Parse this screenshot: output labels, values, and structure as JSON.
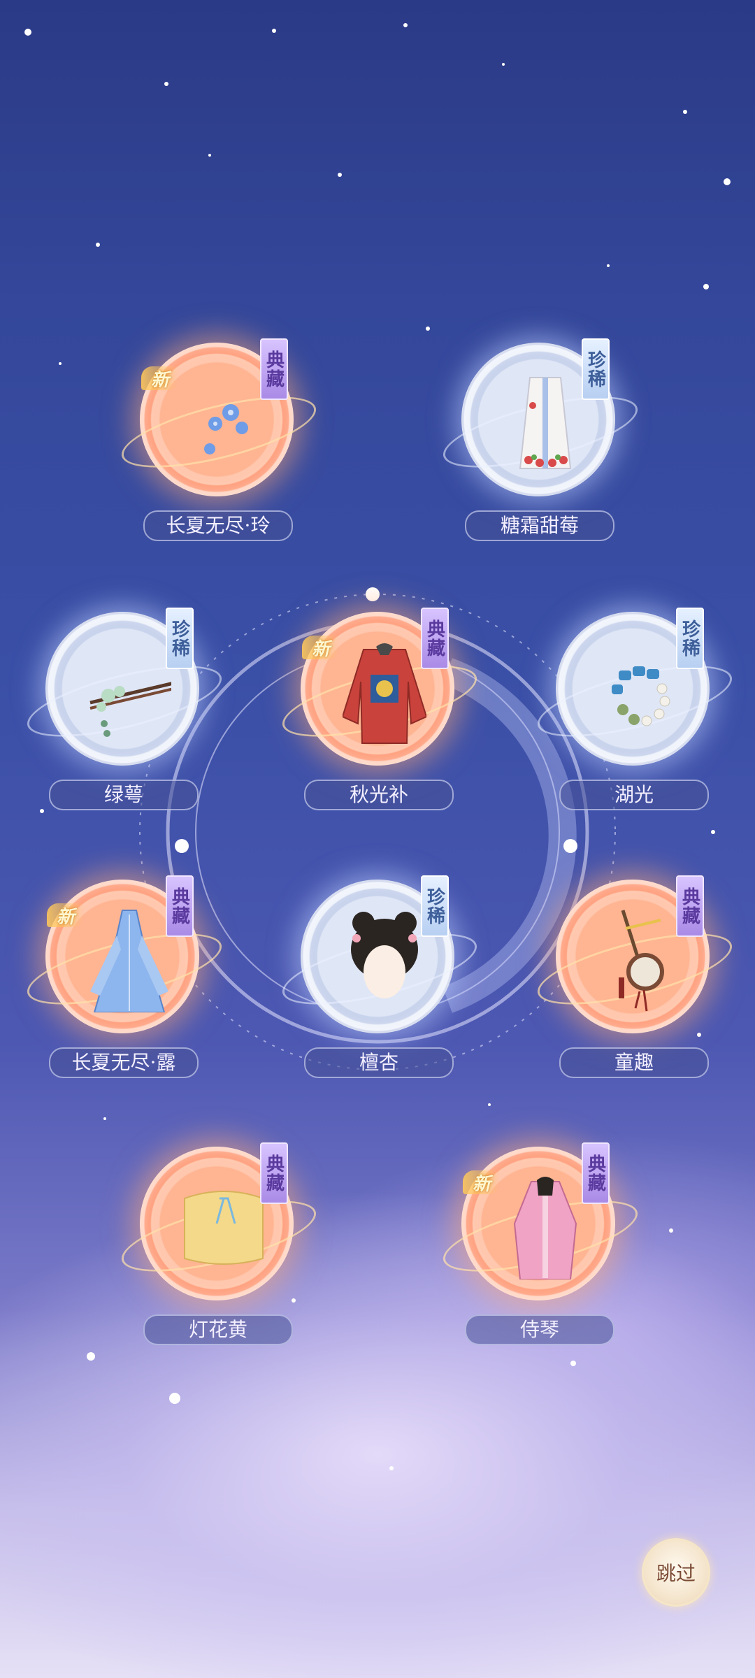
{
  "items": [
    {
      "name": "长夏无尽·玲",
      "tag": "典藏",
      "is_new": true,
      "new_label": "新",
      "rarity": "gold",
      "icon": "hairpin-flower-icon"
    },
    {
      "name": "糖霜甜莓",
      "tag": "珍稀",
      "is_new": false,
      "new_label": "",
      "rarity": "blue",
      "icon": "strawberry-dress-icon"
    },
    {
      "name": "绿萼",
      "tag": "珍稀",
      "is_new": false,
      "new_label": "",
      "rarity": "blue",
      "icon": "hairpin-chopsticks-icon"
    },
    {
      "name": "秋光补",
      "tag": "典藏",
      "is_new": true,
      "new_label": "新",
      "rarity": "gold",
      "icon": "red-robe-icon"
    },
    {
      "name": "湖光",
      "tag": "珍稀",
      "is_new": false,
      "new_label": "",
      "rarity": "blue",
      "icon": "bracelet-icon"
    },
    {
      "name": "长夏无尽·露",
      "tag": "典藏",
      "is_new": true,
      "new_label": "新",
      "rarity": "gold",
      "icon": "blue-gown-icon"
    },
    {
      "name": "檀杏",
      "tag": "珍稀",
      "is_new": false,
      "new_label": "",
      "rarity": "blue",
      "icon": "hairstyle-icon"
    },
    {
      "name": "童趣",
      "tag": "典藏",
      "is_new": false,
      "new_label": "",
      "rarity": "gold",
      "icon": "rattle-drum-icon"
    },
    {
      "name": "灯花黄",
      "tag": "典藏",
      "is_new": false,
      "new_label": "",
      "rarity": "gold",
      "icon": "yellow-top-icon"
    },
    {
      "name": "侍琴",
      "tag": "典藏",
      "is_new": true,
      "new_label": "新",
      "rarity": "gold",
      "icon": "pink-robe-icon"
    }
  ],
  "skip_button": {
    "label": "跳过"
  }
}
